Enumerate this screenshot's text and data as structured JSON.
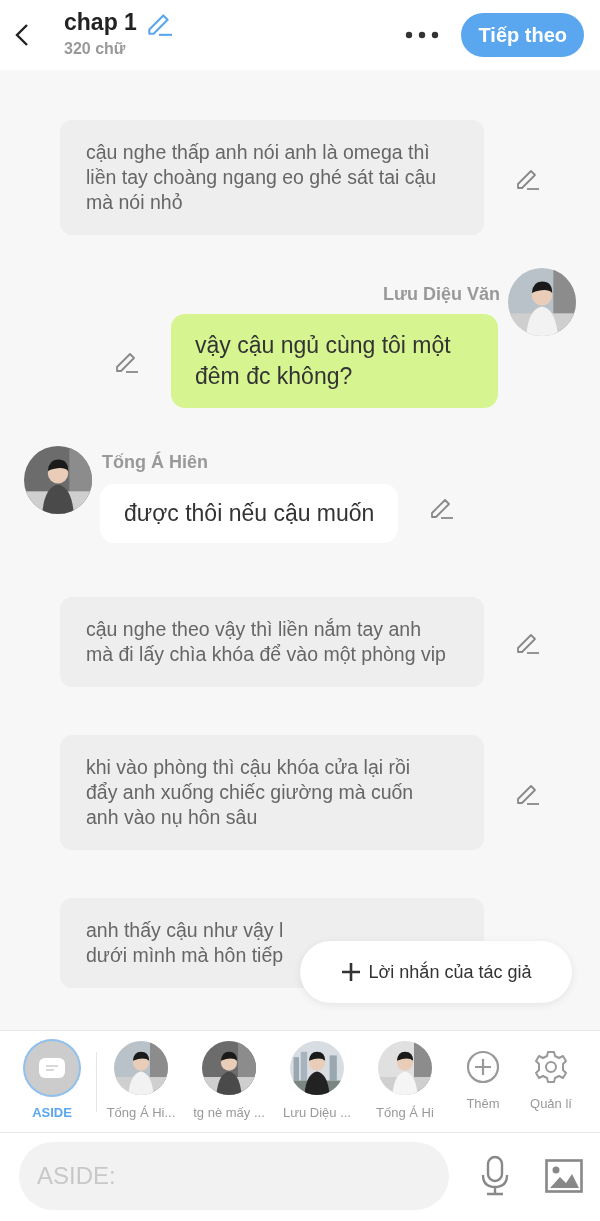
{
  "header": {
    "title": "chap 1",
    "word_count": "320 chữ",
    "next_button": "Tiếp theo"
  },
  "messages": [
    {
      "kind": "aside",
      "text": "cậu nghe thấp anh nói anh là omega thì liền tay choàng ngang eo ghé sát tai cậu mà nói nhỏ"
    },
    {
      "kind": "right",
      "speaker": "Lưu Diệu Văn",
      "text": "vậy cậu ngủ cùng tôi một đêm đc không?"
    },
    {
      "kind": "left",
      "speaker": "Tống Á Hiên",
      "text": "được thôi nếu cậu muốn"
    },
    {
      "kind": "aside",
      "text": "cậu nghe theo vậy thì liền nắm tay anh mà đi lấy chìa khóa để vào một phòng vip"
    },
    {
      "kind": "aside",
      "text": "khi vào phòng thì cậu khóa cửa lại rồi đẩy anh xuống chiếc giường mà cuốn anh vào nụ hôn sâu"
    },
    {
      "kind": "aside",
      "text": "anh thấy cậu như vậy l\ndưới mình mà hôn tiếp"
    }
  ],
  "author_note_button": "Lời nhắn của tác giả",
  "characters": [
    {
      "kind": "aside",
      "label": "ASIDE",
      "selected": true
    },
    {
      "kind": "avatar",
      "label": "Tống Á Hi...",
      "selected": false
    },
    {
      "kind": "avatar",
      "label": "tg nè mấy ...",
      "selected": false
    },
    {
      "kind": "avatar",
      "label": "Lưu Diệu ...",
      "selected": false
    },
    {
      "kind": "avatar",
      "label": "Tống Á Hi",
      "selected": false
    }
  ],
  "actions": [
    {
      "kind": "add",
      "label": "Thêm"
    },
    {
      "kind": "settings",
      "label": "Quản lí"
    }
  ],
  "input": {
    "placeholder": "ASIDE:"
  }
}
